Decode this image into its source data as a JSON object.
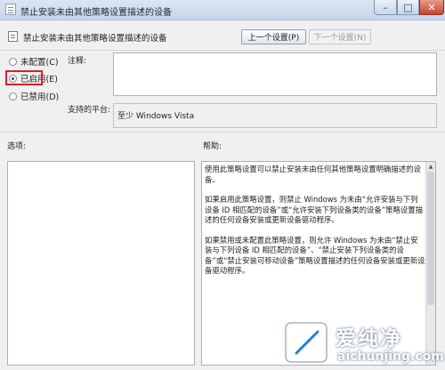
{
  "window": {
    "title": "禁止安装未由其他策略设置描述的设备",
    "minimize": "–",
    "maximize": "□",
    "close": "✕"
  },
  "header": {
    "policy_title": "禁止安装未由其他策略设置描述的设备",
    "prev_button": "上一个设置(P)",
    "next_button": "下一个设置(N)"
  },
  "state": {
    "not_configured": "未配置(C)",
    "enabled": "已启用(E)",
    "disabled": "已禁用(D)",
    "selected": "enabled"
  },
  "comment": {
    "label": "注释:",
    "value": ""
  },
  "supported": {
    "label": "支持的平台:",
    "value": "至少 Windows Vista"
  },
  "options": {
    "label": "选项:"
  },
  "help": {
    "label": "帮助:",
    "paragraphs": [
      "使用此策略设置可以禁止安装未由任何其他策略设置明确描述的设备。",
      "如果启用此策略设置，则禁止 Windows 为未由“允许安装与下列设备 ID 相匹配的设备”或“允许安装下列设备类的设备”策略设置描述的任何设备安装或更新设备驱动程序。",
      "如果禁用或未配置此策略设置，则允许 Windows 为未由“禁止安装与下列设备 ID 相匹配的设备”、“禁止安装下列设备类的设备”或“禁止安装可移动设备”策略设置描述的任何设备安装或更新设备驱动程序。"
    ]
  },
  "watermark": {
    "name": "爱纯净",
    "url": "aichunjing.com"
  }
}
